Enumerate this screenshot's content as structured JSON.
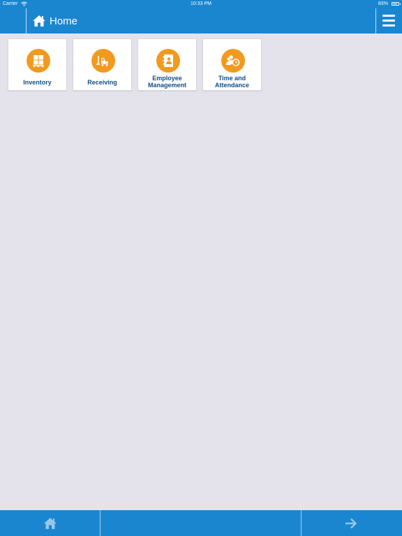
{
  "status_bar": {
    "carrier": "Carrier",
    "time": "10:33 PM",
    "battery": "83%"
  },
  "header": {
    "title": "Home",
    "home_icon": "home-icon",
    "menu_icon": "hamburger-menu-icon"
  },
  "tiles": [
    {
      "label": "Inventory",
      "icon": "pallet-boxes-icon"
    },
    {
      "label": "Receiving",
      "icon": "forklift-icon"
    },
    {
      "label": "Employee Management",
      "line1": "Employee",
      "line2": "Management",
      "icon": "employee-badge-icon"
    },
    {
      "label": "Time and Attendance",
      "line1": "Time and",
      "line2": "Attendance",
      "icon": "people-clock-icon"
    }
  ],
  "bottom_bar": {
    "left_icon": "home-icon",
    "right_icon": "arrow-right-icon"
  },
  "colors": {
    "primary": "#1a86d0",
    "accent": "#f19a1f",
    "tile_text": "#124e86",
    "background": "#e4e3ec"
  }
}
